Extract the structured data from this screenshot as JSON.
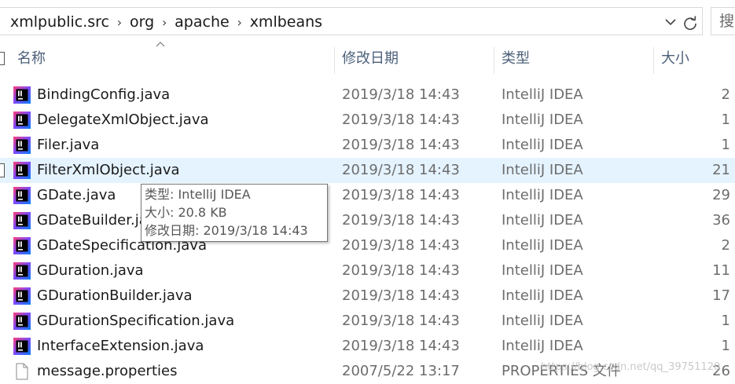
{
  "address": {
    "breadcrumbs": [
      "xmlpublic.src",
      "org",
      "apache",
      "xmlbeans"
    ],
    "separator": "›",
    "search_placeholder": "搜"
  },
  "columns": {
    "name": "名称",
    "date": "修改日期",
    "type": "类型",
    "size": "大小"
  },
  "files": [
    {
      "name": "BindingConfig.java",
      "date": "2019/3/18 14:43",
      "type": "IntelliJ IDEA",
      "size": "2",
      "icon": "intellij-icon"
    },
    {
      "name": "DelegateXmlObject.java",
      "date": "2019/3/18 14:43",
      "type": "IntelliJ IDEA",
      "size": "1",
      "icon": "intellij-icon"
    },
    {
      "name": "Filer.java",
      "date": "2019/3/18 14:43",
      "type": "IntelliJ IDEA",
      "size": "1",
      "icon": "intellij-icon"
    },
    {
      "name": "FilterXmlObject.java",
      "date": "2019/3/18 14:43",
      "type": "IntelliJ IDEA",
      "size": "21",
      "icon": "intellij-icon"
    },
    {
      "name": "GDate.java",
      "date": "2019/3/18 14:43",
      "type": "IntelliJ IDEA",
      "size": "29",
      "icon": "intellij-icon"
    },
    {
      "name": "GDateBuilder.java",
      "date": "2019/3/18 14:43",
      "type": "IntelliJ IDEA",
      "size": "36",
      "icon": "intellij-icon"
    },
    {
      "name": "GDateSpecification.java",
      "date": "2019/3/18 14:43",
      "type": "IntelliJ IDEA",
      "size": "2",
      "icon": "intellij-icon"
    },
    {
      "name": "GDuration.java",
      "date": "2019/3/18 14:43",
      "type": "IntelliJ IDEA",
      "size": "11",
      "icon": "intellij-icon"
    },
    {
      "name": "GDurationBuilder.java",
      "date": "2019/3/18 14:43",
      "type": "IntelliJ IDEA",
      "size": "17",
      "icon": "intellij-icon"
    },
    {
      "name": "GDurationSpecification.java",
      "date": "2019/3/18 14:43",
      "type": "IntelliJ IDEA",
      "size": "1",
      "icon": "intellij-icon"
    },
    {
      "name": "InterfaceExtension.java",
      "date": "2019/3/18 14:43",
      "type": "IntelliJ IDEA",
      "size": "1",
      "icon": "intellij-icon"
    },
    {
      "name": "message.properties",
      "date": "2007/5/22 13:17",
      "type": "PROPERTIES 文件",
      "size": "26",
      "icon": "generic-file-icon"
    }
  ],
  "tooltip": {
    "type_line": "类型: IntelliJ IDEA",
    "size_line": "大小: 20.8 KB",
    "date_line": "修改日期: 2019/3/18 14:43"
  },
  "watermark": "https://blog.csdn.net/qq_39751120",
  "colors": {
    "hover_row": "#e5f3ff",
    "header_text": "#4c607a",
    "secondary_text": "#6d6d6d"
  }
}
